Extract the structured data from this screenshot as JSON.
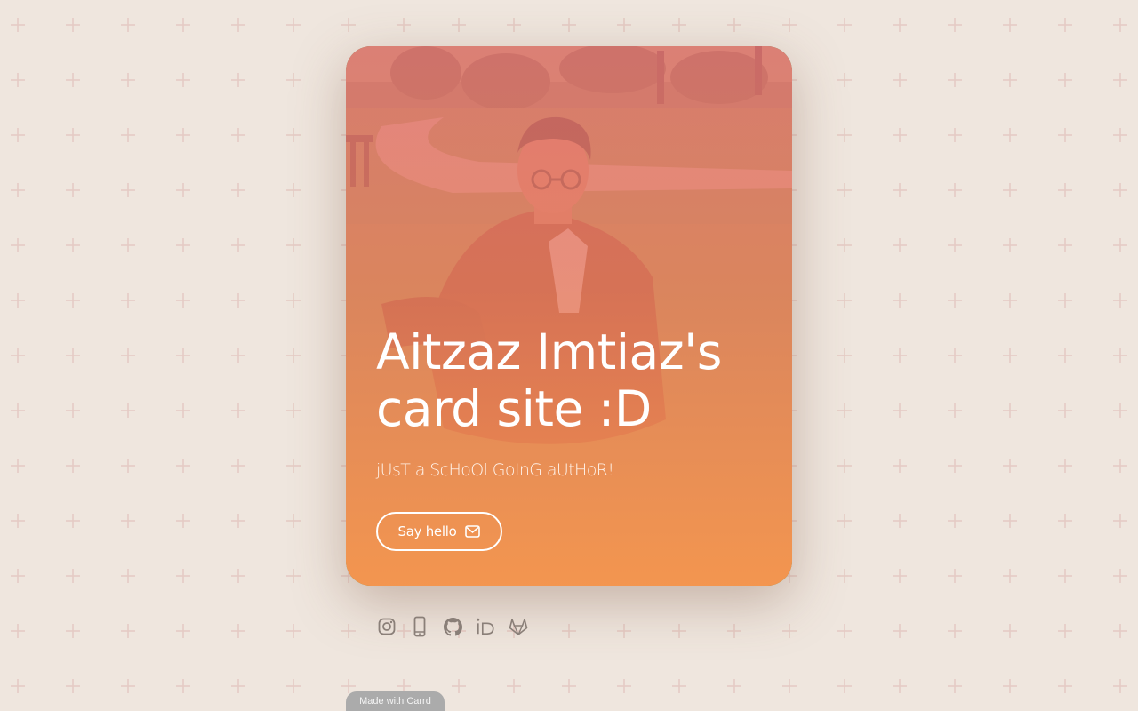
{
  "page": {
    "background_color": "#efe6de",
    "pattern_color": "#e3c9c2"
  },
  "card": {
    "title": "Aitzaz Imtiaz's card site :D",
    "tagline": "jUsT a ScHoOl GoInG aUtHoR!",
    "button_label": "Say hello",
    "button_icon": "envelope-icon",
    "gradient_colors": [
      "#ee7878",
      "#fc9650"
    ]
  },
  "socials": [
    {
      "name": "instagram-icon"
    },
    {
      "name": "phone-icon"
    },
    {
      "name": "github-icon"
    },
    {
      "name": "orcid-icon"
    },
    {
      "name": "gitlab-icon"
    }
  ],
  "footer": {
    "badge": "Made with Carrd"
  }
}
